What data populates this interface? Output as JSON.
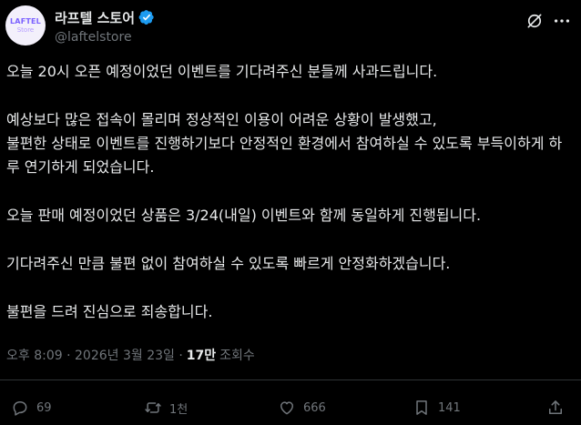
{
  "account": {
    "display_name": "라프텔 스토어",
    "handle": "@laftelstore",
    "avatar_text_top": "LAFTEL",
    "avatar_text_bottom": "Store",
    "verified": true
  },
  "tweet": {
    "paragraphs": [
      "오늘 20시 오픈 예정이었던 이벤트를 기다려주신 분들께 사과드립니다.",
      "예상보다 많은 접속이 몰리며 정상적인 이용이 어려운 상황이 발생했고,\n불편한 상태로 이벤트를 진행하기보다 안정적인 환경에서 참여하실 수 있도록 부득이하게 하루 연기하게 되었습니다.",
      "오늘 판매 예정이었던 상품은 3/24(내일) 이벤트와 함께 동일하게 진행됩니다.",
      "기다려주신 만큼 불편 없이 참여하실 수 있도록 빠르게 안정화하겠습니다.",
      "불편을 드려 진심으로 죄송합니다."
    ],
    "timestamp": "오후 8:09 · 2026년 3월 23일 ·",
    "views_count": "17만",
    "views_label": "조회수"
  },
  "actions": {
    "reply_count": "69",
    "retweet_count": "1천",
    "like_count": "666",
    "bookmark_count": "141"
  },
  "colors": {
    "background": "#000000",
    "text": "#e7e9ea",
    "muted": "#71767b",
    "verified": "#1d9bf0",
    "divider": "#2f3336"
  },
  "icons": {
    "verified": "verified-badge-icon",
    "grok": "grok-icon",
    "more": "more-options-icon",
    "reply": "reply-icon",
    "retweet": "retweet-icon",
    "like": "heart-icon",
    "bookmark": "bookmark-icon",
    "share": "share-icon"
  }
}
